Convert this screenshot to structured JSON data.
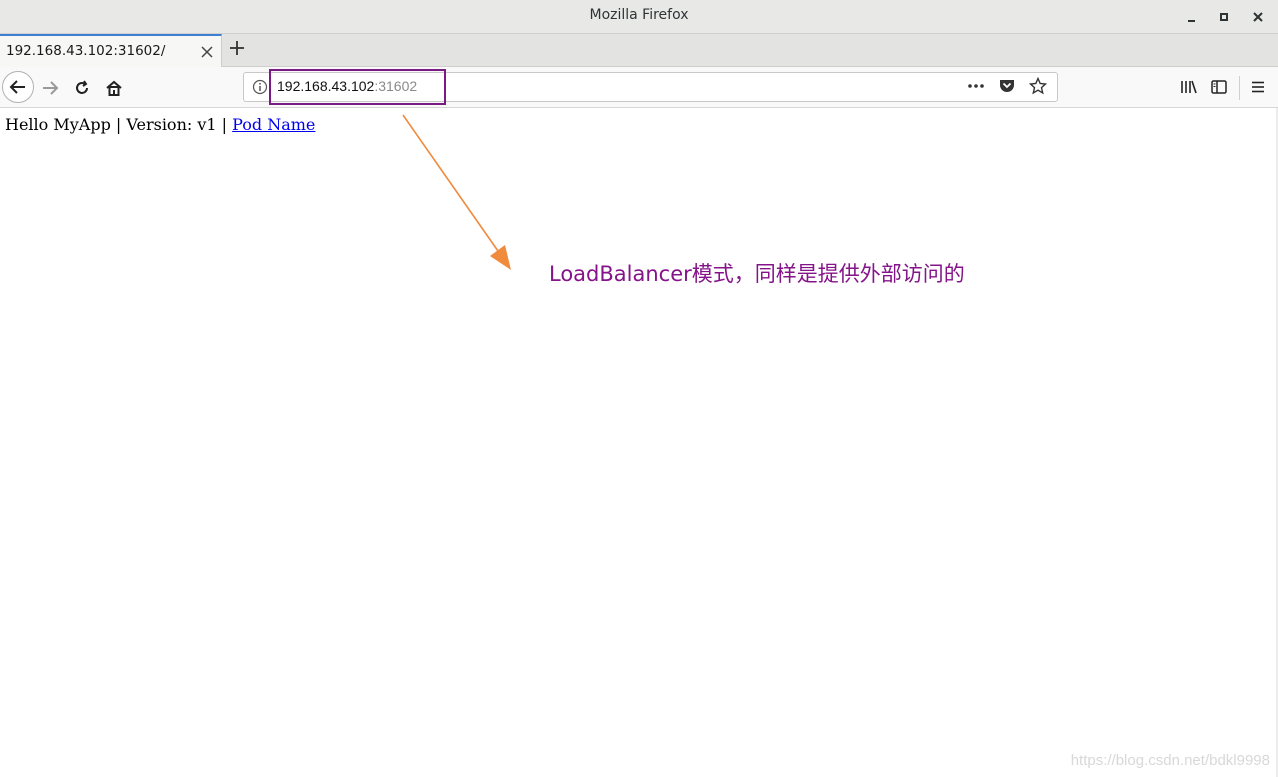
{
  "window": {
    "title": "Mozilla Firefox",
    "minimize": "_",
    "maximize": "□",
    "close": "✕"
  },
  "tabs": [
    {
      "title": "192.168.43.102:31602/",
      "active": true
    }
  ],
  "urlbar": {
    "host": "192.168.43.102",
    "port": ":31602",
    "highlight_color": "#7a1a84"
  },
  "page": {
    "text": "Hello MyApp | Version: v1 | ",
    "link_text": "Pod Name"
  },
  "annotation": {
    "text": "LoadBalancer模式，同样是提供外部访问的",
    "color": "#85138a",
    "arrow_color": "#f08a3c"
  },
  "watermark": "https://blog.csdn.net/bdkl9998"
}
